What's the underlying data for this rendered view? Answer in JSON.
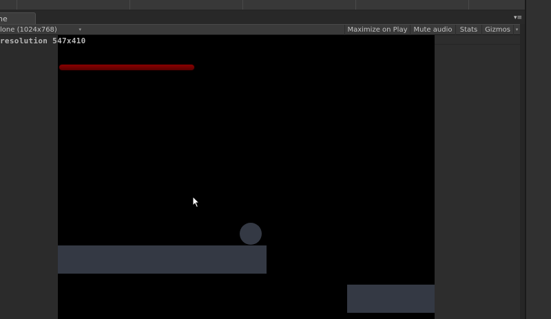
{
  "tab": {
    "label": "ne",
    "menu_glyph": "▾≡"
  },
  "toolbar": {
    "aspect_label": "lone (1024x768)",
    "aspect_arrow": "▾",
    "maximize_label": "Maximize on Play",
    "mute_label": "Mute audio",
    "stats_label": "Stats",
    "gizmos_label": "Gizmos",
    "gizmos_arrow": "▾"
  },
  "view": {
    "resolution_label": "resolution 547x410"
  },
  "game": {
    "health_fraction": 1.0,
    "colors": {
      "background": "#000000",
      "health": "#8a0000",
      "platform": "#343944"
    }
  },
  "icons": {
    "cursor": "arrow-cursor-icon"
  }
}
